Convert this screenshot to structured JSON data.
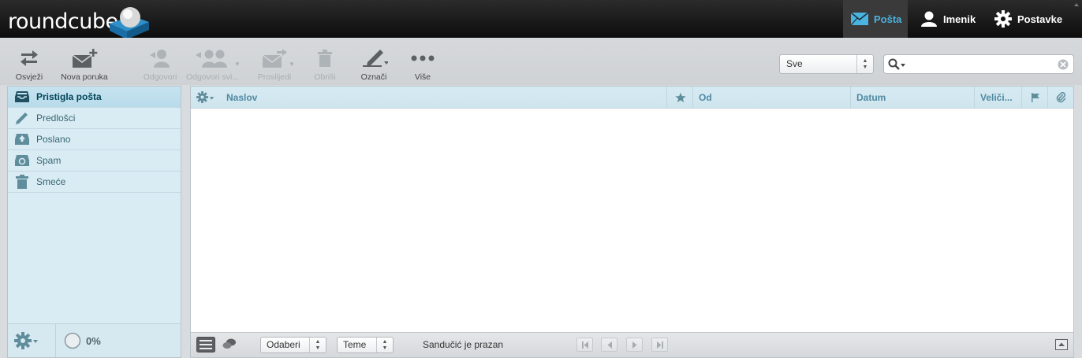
{
  "app": {
    "logo_text": "roundcube"
  },
  "topnav": {
    "mail": "Pošta",
    "contacts": "Imenik",
    "settings": "Postavke"
  },
  "toolbar": {
    "refresh": "Osvježi",
    "compose": "Nova poruka",
    "reply": "Odgovori",
    "reply_all": "Odgovori svi...",
    "forward": "Proslijedi",
    "delete": "Obriši",
    "mark": "Označi",
    "more": "Više"
  },
  "filter": {
    "selected": "Sve"
  },
  "search": {
    "value": "",
    "placeholder": ""
  },
  "folders": [
    {
      "label": "Pristigla pošta",
      "icon": "inbox-icon",
      "selected": true
    },
    {
      "label": "Predlošci",
      "icon": "pencil-icon"
    },
    {
      "label": "Poslano",
      "icon": "sent-icon"
    },
    {
      "label": "Spam",
      "icon": "spam-icon"
    },
    {
      "label": "Smeće",
      "icon": "trash-icon"
    }
  ],
  "quota": {
    "text": "0%",
    "value": 0
  },
  "columns": {
    "subject": "Naslov",
    "from": "Od",
    "date": "Datum",
    "size": "Veliči..."
  },
  "footer": {
    "select": "Odaberi",
    "threads": "Teme",
    "count": "Sandučić je prazan"
  },
  "colors": {
    "accent": "#4ab3e0",
    "header_text": "#4f8aa2",
    "folder_text": "#376572"
  }
}
